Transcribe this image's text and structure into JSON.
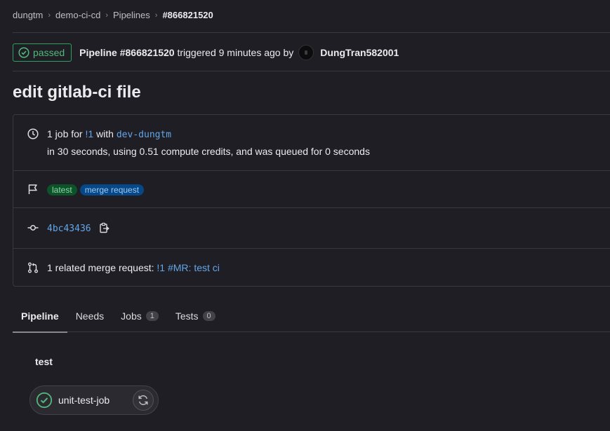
{
  "breadcrumb": [
    "dungtm",
    "demo-ci-cd",
    "Pipelines",
    "#866821520"
  ],
  "header": {
    "status": "passed",
    "pipeline_ref": "Pipeline #866821520",
    "triggered_text": "triggered 9 minutes ago by",
    "author": "DungTran582001"
  },
  "title": "edit gitlab-ci file",
  "info": {
    "jobs_prefix": "1 job for",
    "mr_ref": "!1",
    "with_text": "with",
    "branch": "dev-dungtm",
    "duration_text": "in 30 seconds, using 0.51 compute credits, and was queued for 0 seconds",
    "badges": [
      "latest",
      "merge request"
    ],
    "commit_sha": "4bc43436",
    "related_prefix": "1 related merge request:",
    "related_mr": "!1 #MR: test ci"
  },
  "tabs": [
    {
      "label": "Pipeline",
      "count": null
    },
    {
      "label": "Needs",
      "count": null
    },
    {
      "label": "Jobs",
      "count": "1"
    },
    {
      "label": "Tests",
      "count": "0"
    }
  ],
  "graph": {
    "stage": "test",
    "job": "unit-test-job"
  },
  "colors": {
    "background": "#1f1e24",
    "success": "#52b87a",
    "link": "#63a6e9"
  }
}
